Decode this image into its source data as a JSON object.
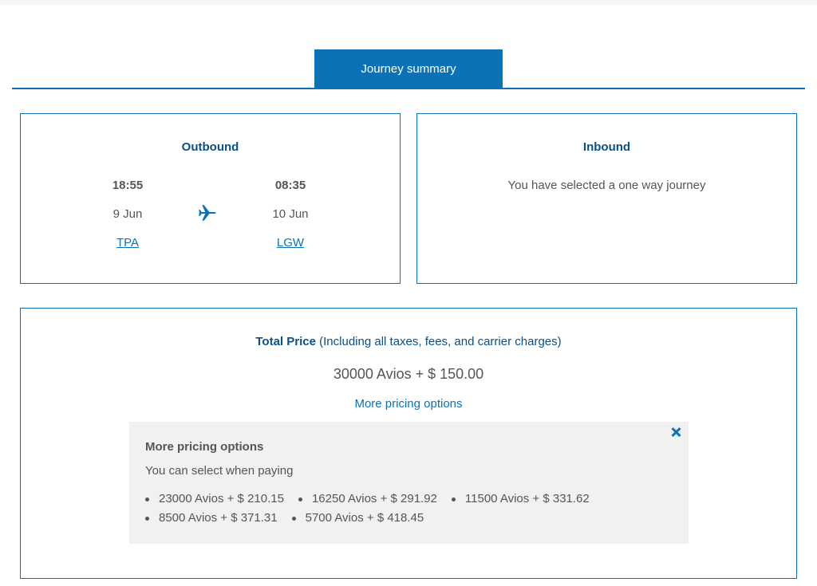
{
  "tabs": [
    {
      "label": "Journey summary",
      "active": true
    }
  ],
  "outbound": {
    "title": "Outbound",
    "departure": {
      "time": "18:55",
      "date": "9 Jun",
      "airport": "TPA"
    },
    "arrival": {
      "time": "08:35",
      "date": "10 Jun",
      "airport": "LGW"
    },
    "icon": "plane-icon"
  },
  "inbound": {
    "title": "Inbound",
    "message": "You have selected a one way journey"
  },
  "pricing": {
    "total_label": "Total Price",
    "total_note": "(Including all taxes, fees, and carrier charges)",
    "total_amount": "30000 Avios + $ 150.00",
    "more_link": "More pricing options",
    "panel": {
      "title": "More pricing options",
      "subtitle": "You can select when paying",
      "options": [
        "23000 Avios + $ 210.15",
        "16250 Avios + $ 291.92",
        "11500 Avios + $ 331.62",
        "8500 Avios + $ 371.31",
        "5700 Avios + $ 418.45"
      ]
    }
  },
  "colors": {
    "accent": "#0b72b8",
    "heading": "#0a4f86",
    "text": "#555555",
    "panel_bg": "#f1f1f1"
  }
}
